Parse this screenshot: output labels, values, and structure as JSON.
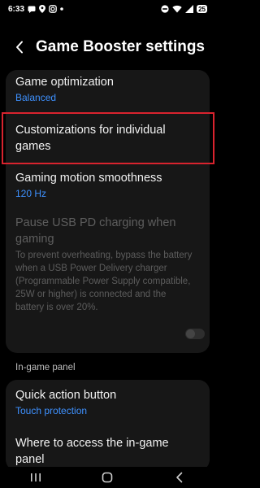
{
  "status_bar": {
    "time": "6:33",
    "battery": "25"
  },
  "header": {
    "title": "Game Booster settings"
  },
  "settings": {
    "game_optimization": {
      "title": "Game optimization",
      "value": "Balanced"
    },
    "customizations": {
      "title": "Customizations for individual games"
    },
    "motion_smoothness": {
      "title": "Gaming motion smoothness",
      "value": "120 Hz"
    },
    "pause_usb": {
      "title": "Pause USB PD charging when gaming",
      "description": "To prevent overheating, bypass the battery when a USB Power Delivery charger (Programmable Power Supply compatible, 25W or higher) is connected and the battery is over 20%.",
      "enabled": false
    }
  },
  "in_game_panel": {
    "section_title": "In-game panel",
    "quick_action": {
      "title": "Quick action button",
      "value": "Touch protection"
    },
    "access": {
      "title": "Where to access the in-game panel"
    }
  },
  "colors": {
    "background": "#000000",
    "card": "#171717",
    "accent": "#3e91ff",
    "highlight": "#d9232e"
  },
  "icons": {
    "back": "chevron-left-icon",
    "recents": "recents-icon",
    "home": "home-icon",
    "nav_back": "back-icon"
  }
}
